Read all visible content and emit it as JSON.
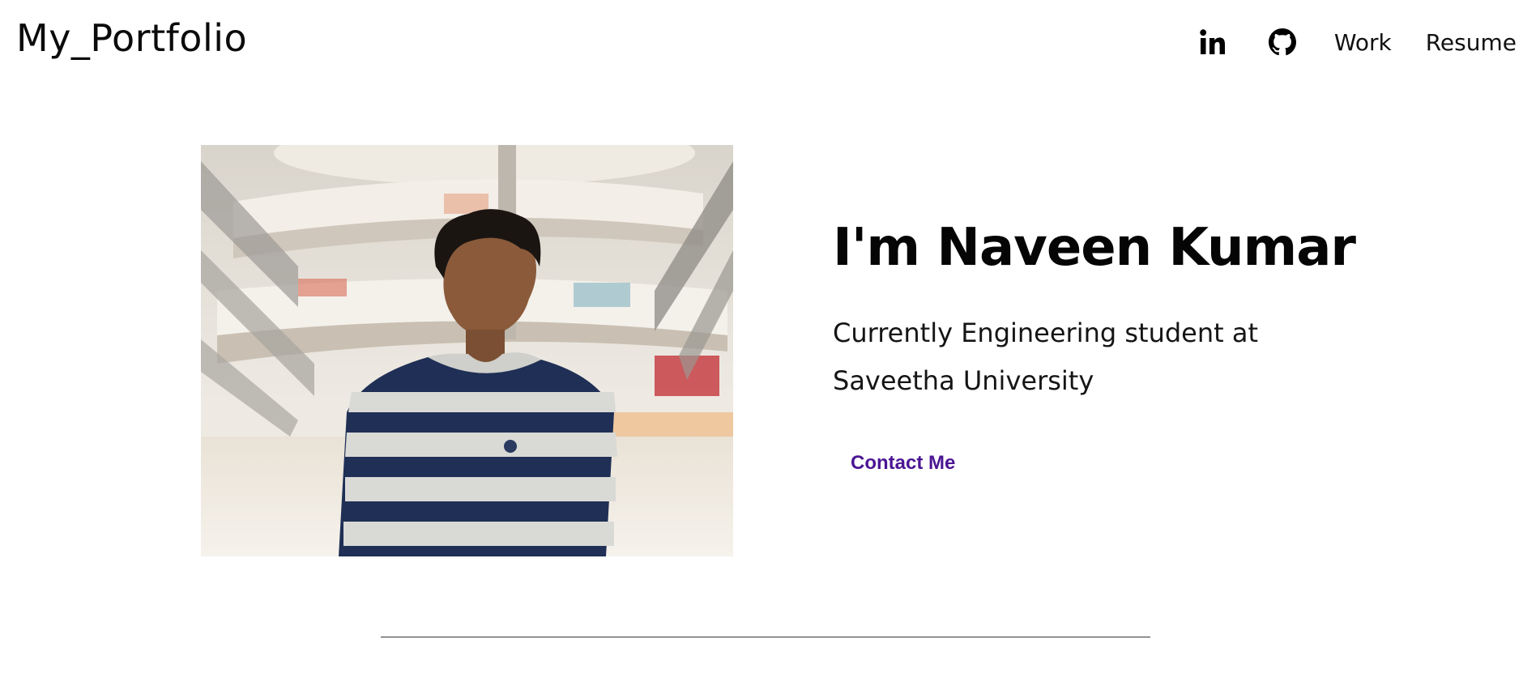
{
  "header": {
    "logo": "My_Portfolio",
    "nav": {
      "linkedin_icon": "linkedin-icon",
      "github_icon": "github-icon",
      "work_label": "Work",
      "resume_label": "Resume"
    }
  },
  "hero": {
    "photo_icon": "profile-photo",
    "title": "I'm Naveen Kumar",
    "subtitle": "Currently Engineering student at Saveetha University",
    "contact_label": "Contact Me"
  },
  "colors": {
    "accent": "#4b1594",
    "text": "#111111",
    "background": "#ffffff"
  }
}
